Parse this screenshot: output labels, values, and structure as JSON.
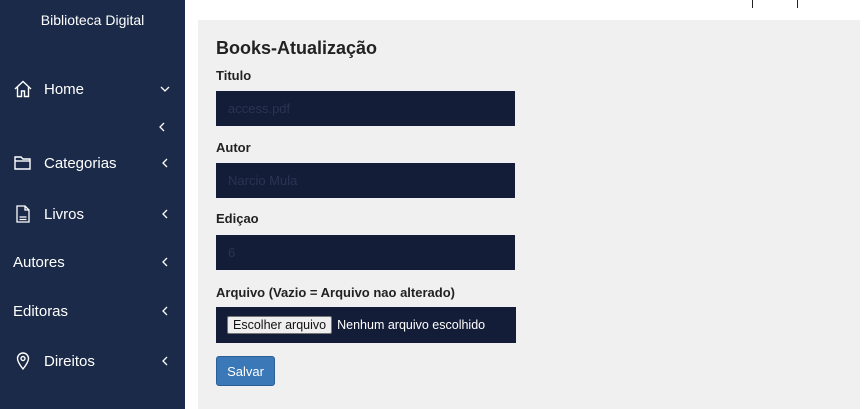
{
  "sidebar": {
    "brand": "Biblioteca Digital",
    "items": [
      {
        "label": "Home",
        "icon": "home-icon",
        "chevron": "chevron-down-icon"
      },
      {
        "label": "Categorias",
        "icon": "folder-icon",
        "chevron": "chevron-left-icon"
      },
      {
        "label": "Livros",
        "icon": "pdf-file-icon",
        "chevron": "chevron-left-icon"
      },
      {
        "label": "Autores",
        "icon": null,
        "chevron": "chevron-left-icon"
      },
      {
        "label": "Editoras",
        "icon": null,
        "chevron": "chevron-left-icon"
      },
      {
        "label": "Direitos",
        "icon": "location-pin-icon",
        "chevron": "chevron-left-icon"
      }
    ]
  },
  "form": {
    "title": "Books-Atualização",
    "fields": [
      {
        "label": "Titulo",
        "value": "access.pdf"
      },
      {
        "label": "Autor",
        "value": "Narcio Mula"
      },
      {
        "label": "Ediçao",
        "value": "6"
      }
    ],
    "file": {
      "label": "Arquivo (Vazio = Arquivo nao alterado)",
      "button_label": "Escolher arquivo",
      "status": "Nenhum arquivo escolhido"
    },
    "submit_label": "Salvar"
  },
  "colors": {
    "sidebar_bg": "#1b2a48",
    "input_bg": "#141d38",
    "content_bg": "#f0f0f0",
    "primary_button": "#3a78b8"
  }
}
